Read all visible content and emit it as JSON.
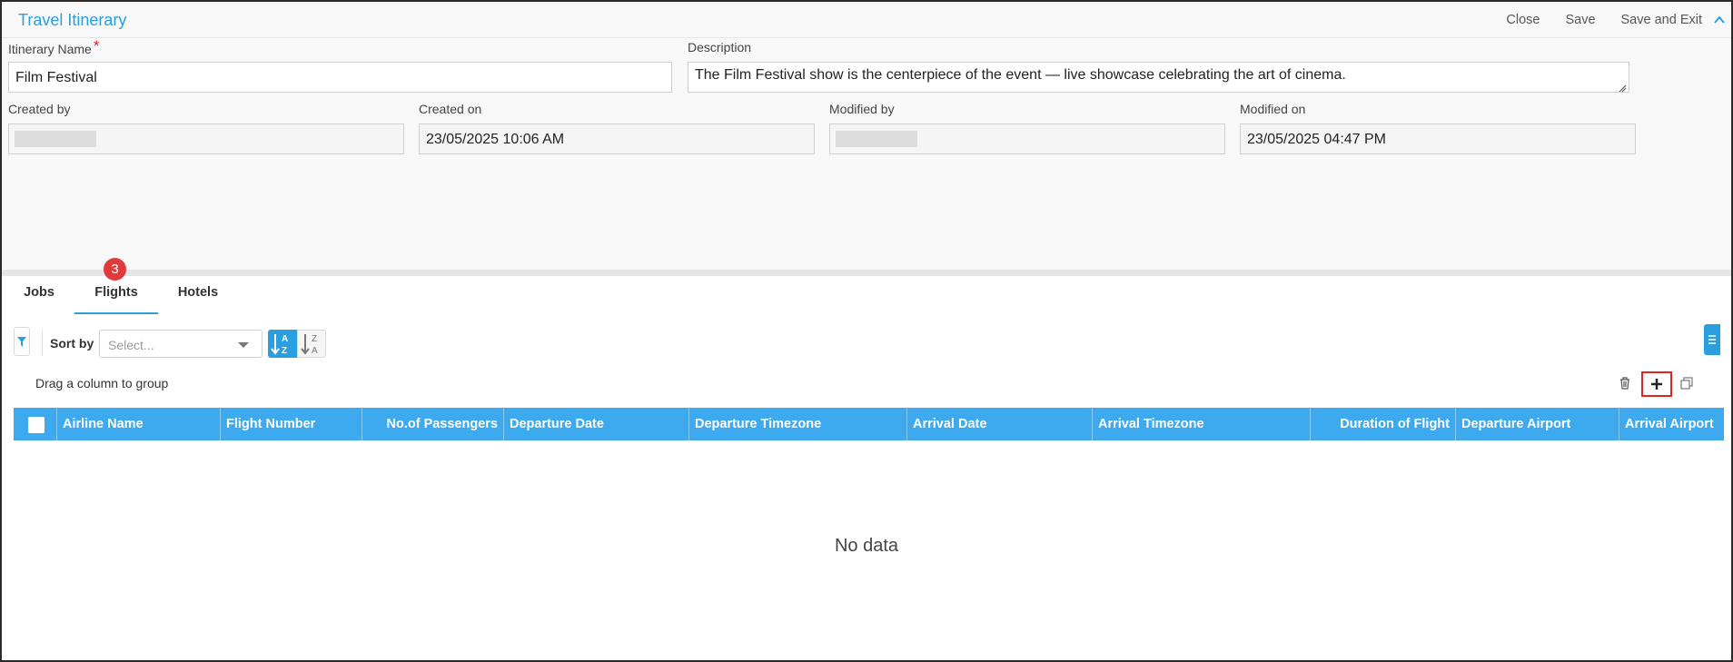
{
  "header": {
    "title": "Travel Itinerary",
    "actions": {
      "close": "Close",
      "save": "Save",
      "save_exit": "Save and Exit"
    }
  },
  "form": {
    "itinerary_name": {
      "label": "Itinerary Name",
      "required_mark": "*",
      "value": "Film Festival"
    },
    "description": {
      "label": "Description",
      "value": "The Film Festival show is the centerpiece of the event — live showcase celebrating the art of cinema."
    },
    "created_by": {
      "label": "Created by"
    },
    "created_on": {
      "label": "Created on",
      "value": "23/05/2025 10:06 AM"
    },
    "modified_by": {
      "label": "Modified by"
    },
    "modified_on": {
      "label": "Modified on",
      "value": "23/05/2025 04:47 PM"
    }
  },
  "tabs": [
    {
      "label": "Jobs"
    },
    {
      "label": "Flights",
      "badge": "3",
      "active": true
    },
    {
      "label": "Hotels"
    }
  ],
  "toolbar": {
    "sort_by_label": "Sort by",
    "sort_placeholder": "Select...",
    "group_hint": "Drag a column to group"
  },
  "grid": {
    "columns": [
      "Airline Name",
      "Flight Number",
      "No.of Passengers",
      "Departure Date",
      "Departure Timezone",
      "Arrival Date",
      "Arrival Timezone",
      "Duration of Flight",
      "Departure Airport",
      "Arrival Airport"
    ],
    "empty_text": "No data"
  },
  "colors": {
    "accent": "#2a9fe0",
    "grid_header": "#3da9ee",
    "badge": "#e03a3a",
    "highlight": "#e02424"
  }
}
